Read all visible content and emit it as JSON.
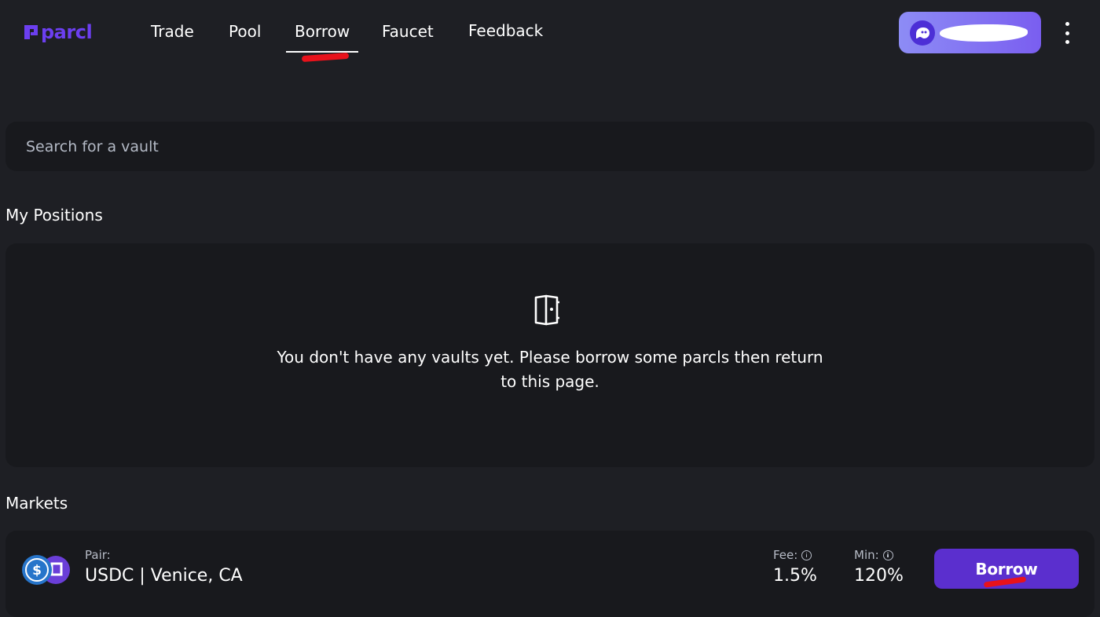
{
  "brand": {
    "name": "parcl",
    "color": "#6c3ff0"
  },
  "nav": {
    "links": [
      {
        "label": "Trade"
      },
      {
        "label": "Pool"
      },
      {
        "label": "Borrow",
        "active": true
      },
      {
        "label": "Faucet"
      },
      {
        "label": "Feedback"
      }
    ]
  },
  "wallet": {
    "icon": "ghost-wallet-icon",
    "address_redacted": true
  },
  "menu": {
    "icon": "kebab-menu-icon"
  },
  "search": {
    "placeholder": "Search for a vault",
    "value": ""
  },
  "positions": {
    "title": "My Positions",
    "empty_icon": "vault-icon",
    "empty_message": "You don't have any vaults yet. Please borrow some parcls then return to this page."
  },
  "markets": {
    "title": "Markets",
    "rows": [
      {
        "pair_label": "Pair:",
        "pair": "USDC | Venice, CA",
        "fee_label": "Fee:",
        "fee": "1.5%",
        "min_label": "Min:",
        "min": "120%",
        "action_label": "Borrow"
      }
    ]
  },
  "colors": {
    "background": "#1e1f24",
    "card": "#18191d",
    "accent": "#5b2fce",
    "annotation": "#e8121b"
  }
}
